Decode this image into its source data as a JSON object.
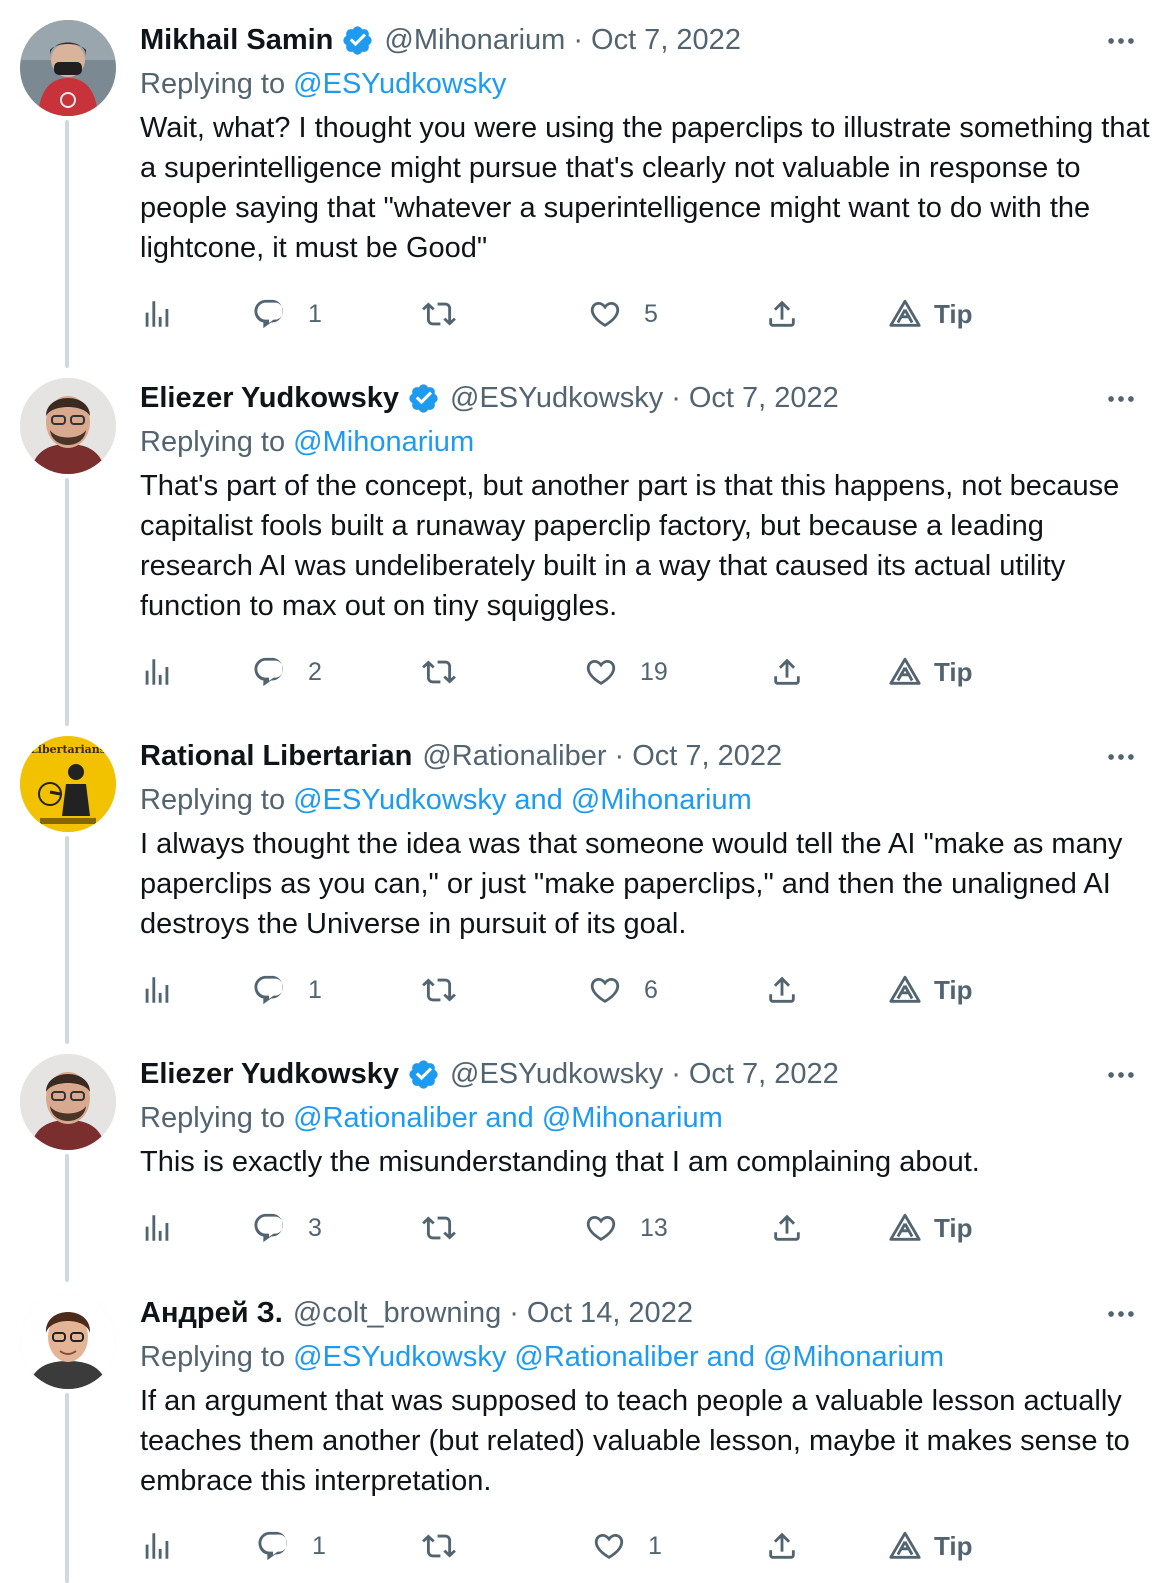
{
  "replying_prefix": "Replying to",
  "tip_label": "Tip",
  "colors": {
    "link": "#1d9bf0",
    "muted": "#536471",
    "text": "#0f1419",
    "line": "#cfd9de"
  },
  "tweets": [
    {
      "name": "Mikhail Samin",
      "verified": true,
      "handle": "@Mihonarium",
      "date": "Oct 7, 2022",
      "reply_parts": [
        "@ESYudkowsky"
      ],
      "text": "Wait, what? I thought you were using the paperclips to illustrate something that a superintelligence might pursue that's clearly not valuable in response to people saying that \"whatever a superintelligence might want to do with the lightcone, it must be Good\"",
      "replies": "1",
      "retweets": "",
      "likes": "5"
    },
    {
      "name": "Eliezer Yudkowsky",
      "verified": true,
      "handle": "@ESYudkowsky",
      "date": "Oct 7, 2022",
      "reply_parts": [
        "@Mihonarium"
      ],
      "text": "That's part of the concept, but another part is that this happens, not because capitalist fools built a runaway paperclip factory, but because a leading research AI was undeliberately built in a way that caused its actual utility function to max out on tiny squiggles.",
      "replies": "2",
      "retweets": "",
      "likes": "19"
    },
    {
      "name": "Rational Libertarian",
      "verified": false,
      "handle": "@Rationaliber",
      "date": "Oct 7, 2022",
      "reply_parts": [
        "@ESYudkowsky and @Mihonarium"
      ],
      "text": "I always thought the idea was that someone would tell the AI \"make as many paperclips as you can,\" or just \"make paperclips,\" and then the unaligned AI destroys the Universe in pursuit of its goal.",
      "replies": "1",
      "retweets": "",
      "likes": "6",
      "avatar_text": "Libertarians"
    },
    {
      "name": "Eliezer Yudkowsky",
      "verified": true,
      "handle": "@ESYudkowsky",
      "date": "Oct 7, 2022",
      "reply_parts": [
        "@Rationaliber and @Mihonarium"
      ],
      "text": "This is exactly the misunderstanding that I am complaining about.",
      "replies": "3",
      "retweets": "",
      "likes": "13"
    },
    {
      "name": "Андрей З.",
      "verified": false,
      "handle": "@colt_browning",
      "date": "Oct 14, 2022",
      "reply_parts": [
        "@ESYudkowsky @Rationaliber and @Mihonarium"
      ],
      "text": "If an argument that was supposed to teach people a valuable lesson actually teaches them another (but related) valuable lesson, maybe it makes sense to embrace this interpretation.",
      "replies": "1",
      "retweets": "",
      "likes": "1"
    }
  ]
}
